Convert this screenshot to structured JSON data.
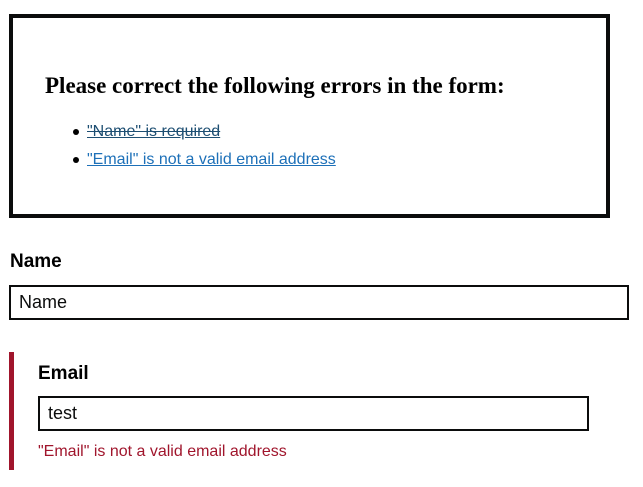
{
  "error_summary": {
    "title": "Please correct the following errors in the form:",
    "items": [
      {
        "text": "\"Name\" is required",
        "resolved": true
      },
      {
        "text": "\"Email\" is not a valid email address",
        "resolved": false
      }
    ]
  },
  "form": {
    "name": {
      "label": "Name",
      "value": "Name"
    },
    "email": {
      "label": "Email",
      "value": "test",
      "error_message": "\"Email\" is not a valid email address"
    }
  },
  "colors": {
    "error": "#a0152c",
    "link": "#1d70b8",
    "border": "#0b0c0c"
  }
}
